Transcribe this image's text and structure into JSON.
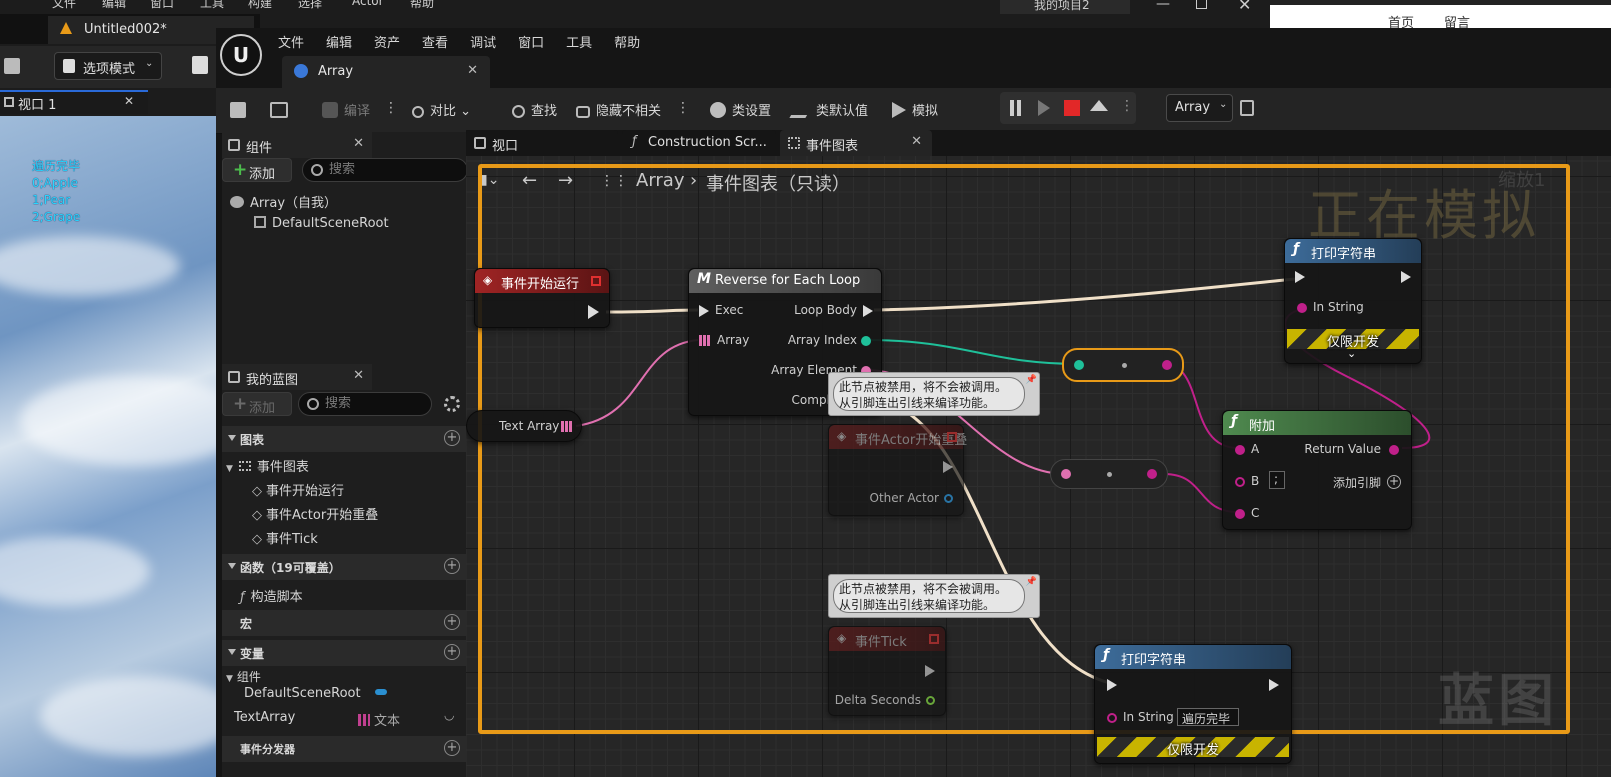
{
  "background_editor": {
    "menu": [
      "文件",
      "编辑",
      "窗口",
      "工具",
      "构建",
      "选择",
      "Actor",
      "帮助"
    ],
    "project_name": "我的项目2",
    "tab_title": "Untitled002*",
    "mode_label": "选项模式",
    "viewport_tab": "视口 1",
    "debug_lines": [
      "遍历完毕",
      "0;Apple",
      "1;Pear",
      "2;Grape"
    ],
    "right_window_links": [
      "首页",
      "留言"
    ]
  },
  "main": {
    "menu": [
      "文件",
      "编辑",
      "资产",
      "查看",
      "调试",
      "窗口",
      "工具",
      "帮助"
    ],
    "doc_tab": "Array",
    "toolbar": {
      "compile": "编译",
      "diff": "对比",
      "find": "查找",
      "hide_unrelated": "隐藏不相关",
      "class_settings": "类设置",
      "class_defaults": "类默认值",
      "simulate": "模拟",
      "debug_object": "Array"
    }
  },
  "components": {
    "title": "组件",
    "add": "添加",
    "search_placeholder": "搜索",
    "root": "Array（自我）",
    "child": "DefaultSceneRoot"
  },
  "my_blueprint": {
    "title": "我的蓝图",
    "add": "添加",
    "search_placeholder": "搜索",
    "cat_graphs": "图表",
    "event_graph": "事件图表",
    "events": [
      "事件开始运行",
      "事件Actor开始重叠",
      "事件Tick"
    ],
    "cat_functions": "函数（19可覆盖）",
    "construction": "构造脚本",
    "cat_macros": "宏",
    "cat_variables": "变量",
    "var_group": "组件",
    "var_default_root": "DefaultSceneRoot",
    "var_text_array": "TextArray",
    "var_text_type": "文本",
    "cat_dispatchers": "事件分发器"
  },
  "graph": {
    "tabs": [
      "视口",
      "Construction Scr...",
      "事件图表"
    ],
    "breadcrumb_root": "Array",
    "breadcrumb_graph": "事件图表（只读）",
    "zoom": "缩放1",
    "simulating_watermark": "正在模拟",
    "blueprint_watermark": "蓝图",
    "nodes": {
      "begin_play": "事件开始运行",
      "reverse_loop": "Reverse for Each Loop",
      "reverse_loop_icon": "M",
      "exec": "Exec",
      "loop_body": "Loop Body",
      "array": "Array",
      "array_index": "Array Index",
      "array_element": "Array Element",
      "completed": "Completed",
      "text_array": "Text Array",
      "print_top": "打印字符串",
      "in_string": "In String",
      "dev_only": "仅限开发",
      "append": "附加",
      "a": "A",
      "b": "B",
      "b_value": ";",
      "c": "C",
      "return_value": "Return Value",
      "add_pin": "添加引脚",
      "actor_overlap": "事件Actor开始重叠",
      "other_actor": "Other Actor",
      "tick": "事件Tick",
      "delta_seconds": "Delta Seconds",
      "print_bottom": "打印字符串",
      "print_bottom_value": "遍历完毕",
      "disabled_line1": "此节点被禁用，将不会被调用。",
      "disabled_line2": "从引脚连出引线来编译功能。"
    }
  },
  "colors": {
    "simulating_border": "#e89a18",
    "exec_wire": "#f0e0c8",
    "array_wire": "#e070b0",
    "int_wire": "#1fc09a",
    "text_wire": "#c0208a",
    "event_header": "#8a1c1c",
    "function_header": "#3d6c9a",
    "pure_header": "#3f7a3f"
  }
}
